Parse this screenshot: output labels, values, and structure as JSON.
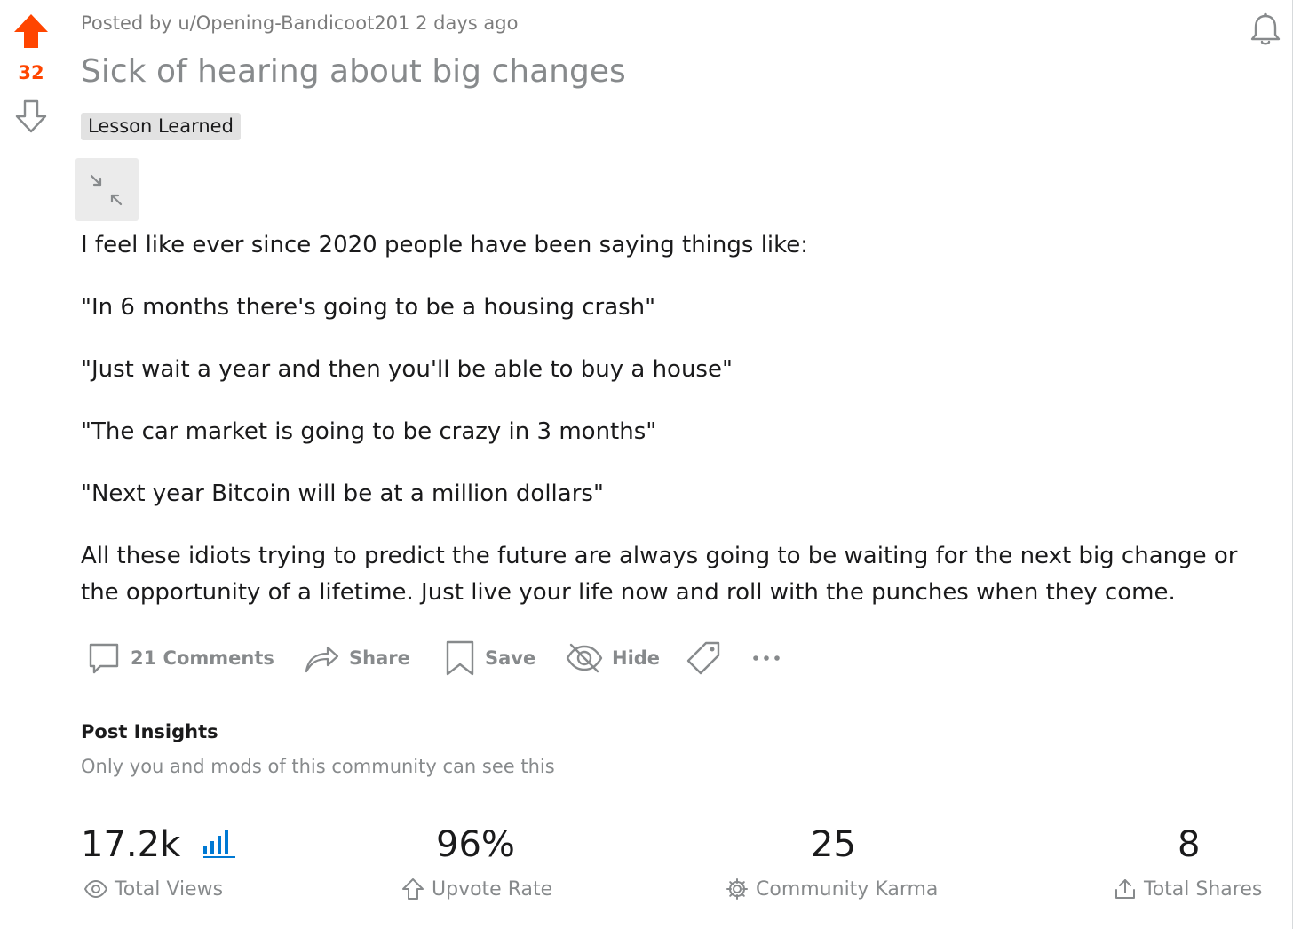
{
  "vote": {
    "score": "32"
  },
  "post": {
    "posted_by_prefix": "Posted by",
    "author": "u/Opening-Bandicoot201",
    "time": "2 days ago",
    "title": "Sick of hearing about big changes",
    "flair": "Lesson Learned",
    "paragraphs": [
      "I feel like ever since 2020 people have been saying things like:",
      "\"In 6 months there's going to be a housing crash\"",
      "\"Just wait a year and then you'll be able to buy a house\"",
      "\"The car market is going to be crazy in 3 months\"",
      "\"Next year Bitcoin will be at a million dollars\"",
      "All these idiots trying to predict the future are always going to be waiting for the next big change or the opportunity of a lifetime. Just live your life now and roll with the punches when they come."
    ]
  },
  "actions": {
    "comments": "21 Comments",
    "share": "Share",
    "save": "Save",
    "hide": "Hide"
  },
  "insights": {
    "title": "Post Insights",
    "subtitle": "Only you and mods of this community can see this",
    "stats": [
      {
        "value": "17.2k",
        "label": "Total Views",
        "icon": "eye-icon"
      },
      {
        "value": "96%",
        "label": "Upvote Rate",
        "icon": "upvote-outline-icon"
      },
      {
        "value": "25",
        "label": "Community Karma",
        "icon": "gear-icon"
      },
      {
        "value": "8",
        "label": "Total Shares",
        "icon": "share-upload-icon"
      }
    ]
  },
  "colors": {
    "upvote_active": "#ff4500",
    "muted_text": "#878a8c",
    "meta_text": "#7c7c7c",
    "flair_bg": "#e2e2e2",
    "link_blue": "#0079d3",
    "body_text": "#1a1a1b"
  }
}
